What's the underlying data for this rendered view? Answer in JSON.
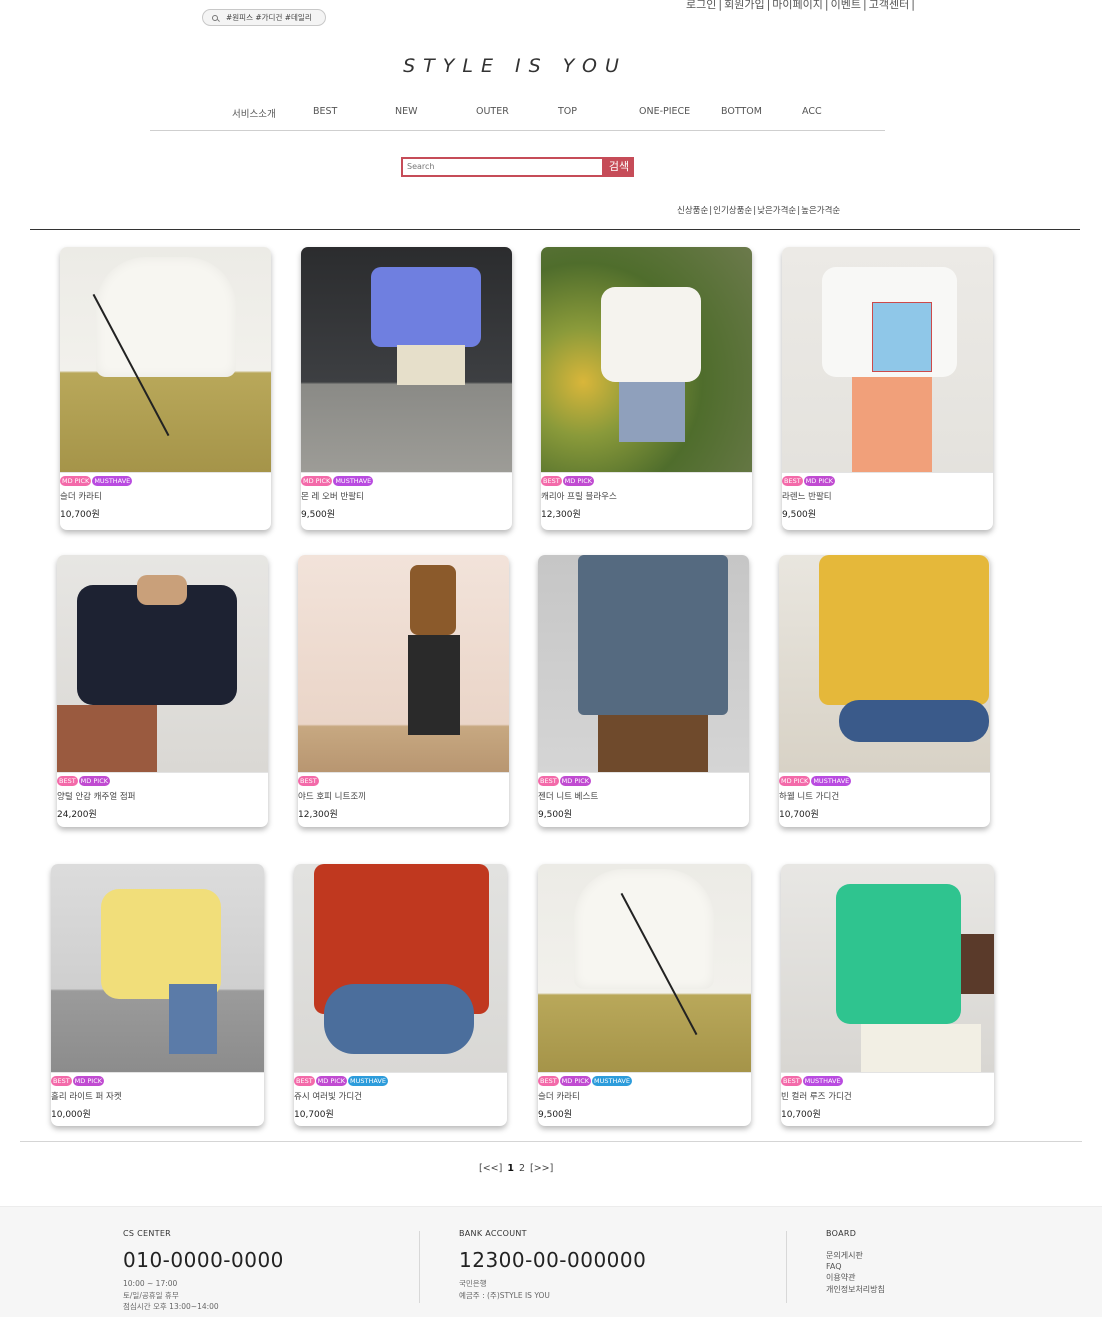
{
  "header": {
    "tag_search_text": "#원피스 #가디건 #데일리",
    "top_links": [
      "로그인",
      "회원가입",
      "마이페이지",
      "이벤트",
      "고객센터"
    ],
    "logo": "STYLE IS YOU"
  },
  "nav": {
    "items": [
      "서비스소개",
      "BEST",
      "NEW",
      "OUTER",
      "TOP",
      "ONE-PIECE",
      "BOTTOM",
      "ACC"
    ]
  },
  "search": {
    "placeholder": "Search",
    "button": "검색"
  },
  "sort": {
    "options": [
      "신상품순",
      "인기상품순",
      "낮은가격순",
      "높은가격순"
    ]
  },
  "products": [
    {
      "name": "슬더 카라티",
      "price": "10,700원",
      "badges": [
        "MD PICK",
        "MUSTHAVE"
      ],
      "image": "cream-cardigan-khaki-pants"
    },
    {
      "name": "몬 레 오버 반팔티",
      "price": "9,500원",
      "badges": [
        "MD PICK",
        "MUSTHAVE"
      ],
      "image": "blue-tee-beige-shorts"
    },
    {
      "name": "캐리아 프릴 블라우스",
      "price": "12,300원",
      "badges": [
        "BEST",
        "MD PICK"
      ],
      "image": "white-frill-blouse"
    },
    {
      "name": "라렌느 반팔티",
      "price": "9,500원",
      "badges": [
        "BEST",
        "MD PICK"
      ],
      "image": "white-graphic-tee-orange-pants"
    },
    {
      "name": "양털 안감 캐주얼 점퍼",
      "price": "24,200원",
      "badges": [
        "BEST",
        "MD PICK"
      ],
      "image": "navy-fleece-jacket"
    },
    {
      "name": "야드 호피 니트조끼",
      "price": "12,300원",
      "badges": [
        "BEST"
      ],
      "image": "leopard-knit-vest"
    },
    {
      "name": "젠더 니트 베스트",
      "price": "9,500원",
      "badges": [
        "BEST",
        "MD PICK"
      ],
      "image": "blue-cable-knit-vest"
    },
    {
      "name": "하웰 니트 가디건",
      "price": "10,700원",
      "badges": [
        "MD PICK",
        "MUSTHAVE"
      ],
      "image": "yellow-knit-cardigan"
    },
    {
      "name": "홀리 라이트 퍼 자켓",
      "price": "10,000원",
      "badges": [
        "BEST",
        "MD PICK"
      ],
      "image": "yellow-fur-jacket"
    },
    {
      "name": "쥬시 여러빛 가디건",
      "price": "10,700원",
      "badges": [
        "BEST",
        "MD PICK",
        "MUSTHAVE"
      ],
      "image": "red-cable-cardigan"
    },
    {
      "name": "슬더 카라티",
      "price": "9,500원",
      "badges": [
        "BEST",
        "MD PICK",
        "MUSTHAVE"
      ],
      "image": "cream-cardigan-khaki-pants-2"
    },
    {
      "name": "빈 컬러 루즈 가디건",
      "price": "10,700원",
      "badges": [
        "BEST",
        "MUSTHAVE"
      ],
      "image": "green-cardigan"
    }
  ],
  "pagination": {
    "prev": "[<<]",
    "pages": [
      "1",
      "2"
    ],
    "current": "1",
    "next": "[>>]"
  },
  "footer": {
    "cs_title": "CS CENTER",
    "cs_phone": "010-0000-0000",
    "cs_hours": [
      "10:00 ~ 17:00",
      "토/일/공휴일 휴무",
      "점심시간 오후 13:00~14:00"
    ],
    "bank_title": "BANK ACCOUNT",
    "bank_number": "12300-00-000000",
    "bank_lines": [
      "국민은행",
      "예금주 : (주)STYLE IS YOU"
    ],
    "board_title": "BOARD",
    "board_items": [
      "문의게시판",
      "FAQ",
      "이용약관",
      "개인정보처리방침"
    ]
  }
}
